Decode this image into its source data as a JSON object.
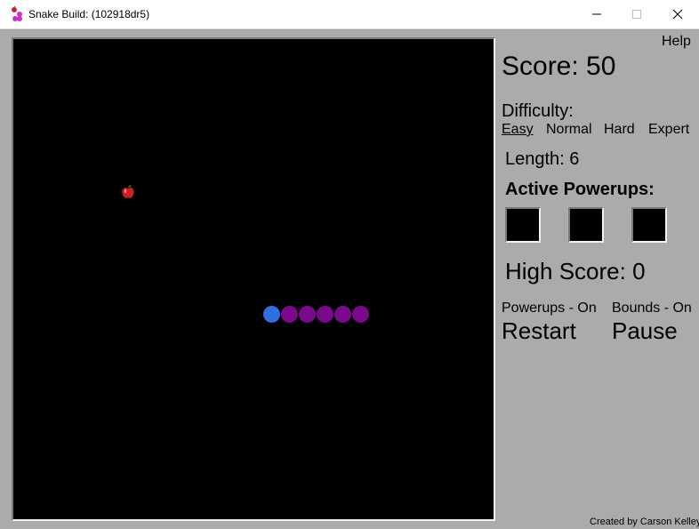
{
  "window": {
    "title": "Snake Build: (102918dr5)",
    "icon": "snake-app-icon",
    "controls": [
      "minimize-icon",
      "maximize-icon",
      "close-icon"
    ]
  },
  "board": {
    "background": "#000000",
    "apple_icon": "apple-icon",
    "snake": {
      "length": 6,
      "head_color": "#2f6fe0",
      "body_color": "#7a0a8c"
    }
  },
  "panel": {
    "help": "Help",
    "score": "Score: 50",
    "difficulty_label": "Difficulty:",
    "difficulty_options": [
      "Easy",
      "Normal",
      "Hard",
      "Expert"
    ],
    "selected_difficulty": "Easy",
    "length": "Length: 6",
    "active_powerups_label": "Active Powerups:",
    "powerup_slot_count": 3,
    "high_score": "High Score: 0",
    "powerups_toggle": "Powerups - On",
    "bounds_toggle": "Bounds - On",
    "restart": "Restart",
    "pause": "Pause",
    "credit": "Created by Carson Kelley"
  },
  "colors": {
    "panel_background": "#ababab",
    "board_background": "#000000"
  }
}
